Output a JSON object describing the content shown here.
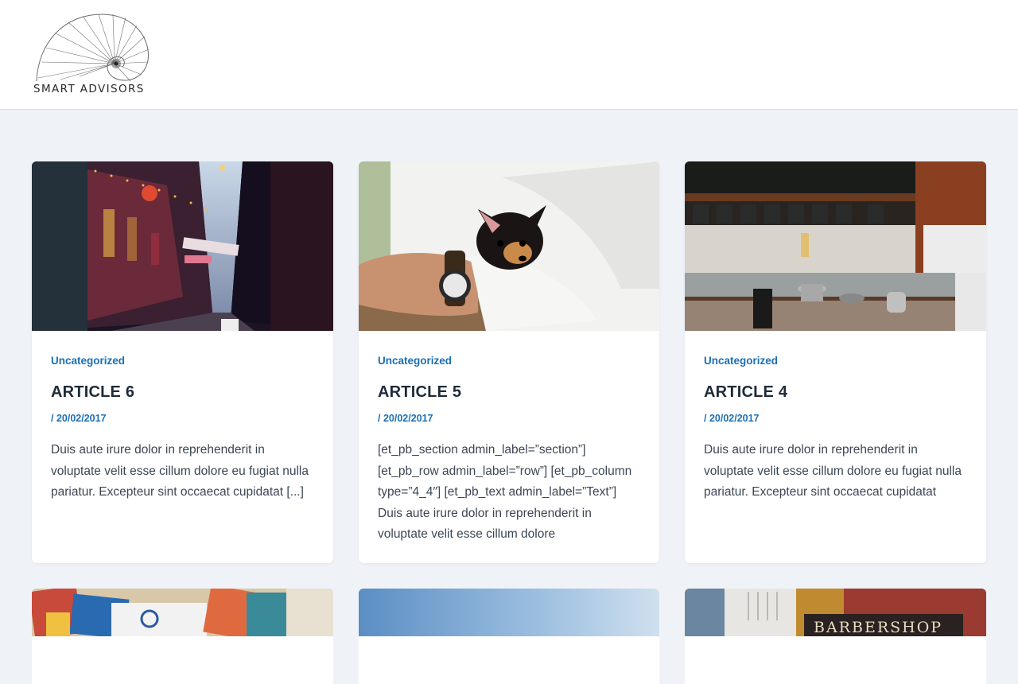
{
  "site": {
    "logo_text": "SMART ADVISORS"
  },
  "posts": [
    {
      "category": "Uncategorized",
      "title": "ARTICLE 6",
      "date": "/ 20/02/2017",
      "excerpt": "Duis aute irure dolor in reprehenderit in voluptate velit esse cillum dolore eu fugiat nulla pariatur. Excepteur sint occaecat cupidatat [...]",
      "image": "neon-alley-street"
    },
    {
      "category": "Uncategorized",
      "title": "ARTICLE 5",
      "date": "/ 20/02/2017",
      "excerpt": "[et_pb_section admin_label=”section”] [et_pb_row admin_label=”row”] [et_pb_column type=”4_4″] [et_pb_text admin_label=”Text”] Duis aute irure dolor in reprehenderit in voluptate velit esse cillum dolore",
      "image": "man-holding-chihuahua"
    },
    {
      "category": "Uncategorized",
      "title": "ARTICLE 4",
      "date": "/ 20/02/2017",
      "excerpt": "Duis aute irure dolor in reprehenderit in voluptate velit esse cillum dolore eu fugiat nulla pariatur. Excepteur sint occaecat cupidatat",
      "image": "cafe-kitchen-counter"
    }
  ],
  "next_row": [
    {
      "image": "colorful-cards-collage"
    },
    {
      "image": "blue-sky-gradient"
    },
    {
      "image": "barbershop-sign",
      "sign_text": "BARBERSHOP"
    }
  ],
  "colors": {
    "page_background": "#eff3f8",
    "accent": "#1a6fb5",
    "title": "#1f2b3a",
    "body_text": "#3c4654"
  }
}
